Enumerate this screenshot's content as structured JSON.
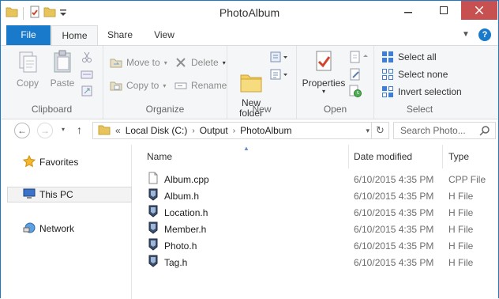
{
  "window": {
    "title": "PhotoAlbum"
  },
  "ribbon_tabs": {
    "file": "File",
    "home": "Home",
    "share": "Share",
    "view": "View"
  },
  "clipboard": {
    "copy": "Copy",
    "paste": "Paste",
    "label": "Clipboard"
  },
  "organize": {
    "move_to": "Move to",
    "copy_to": "Copy to",
    "delete": "Delete",
    "rename": "Rename",
    "label": "Organize"
  },
  "new_group": {
    "new_folder": "New\nfolder",
    "label": "New"
  },
  "open_group": {
    "properties": "Properties",
    "label": "Open"
  },
  "select_group": {
    "select_all": "Select all",
    "select_none": "Select none",
    "invert": "Invert selection",
    "label": "Select"
  },
  "address": {
    "overflow": "«",
    "crumbs": [
      "Local Disk (C:)",
      "Output",
      "PhotoAlbum"
    ],
    "search_placeholder": "Search Photo..."
  },
  "nav_pane": {
    "favorites": "Favorites",
    "this_pc": "This PC",
    "network": "Network"
  },
  "columns": {
    "name": "Name",
    "date": "Date modified",
    "type": "Type"
  },
  "files": [
    {
      "name": "Album.cpp",
      "date": "6/10/2015 4:35 PM",
      "type": "CPP File",
      "icon": "cpp-file-icon"
    },
    {
      "name": "Album.h",
      "date": "6/10/2015 4:35 PM",
      "type": "H File",
      "icon": "h-file-icon"
    },
    {
      "name": "Location.h",
      "date": "6/10/2015 4:35 PM",
      "type": "H File",
      "icon": "h-file-icon"
    },
    {
      "name": "Member.h",
      "date": "6/10/2015 4:35 PM",
      "type": "H File",
      "icon": "h-file-icon"
    },
    {
      "name": "Photo.h",
      "date": "6/10/2015 4:35 PM",
      "type": "H File",
      "icon": "h-file-icon"
    },
    {
      "name": "Tag.h",
      "date": "6/10/2015 4:35 PM",
      "type": "H File",
      "icon": "h-file-icon"
    }
  ],
  "colors": {
    "accent": "#1979ca",
    "close": "#c75050",
    "ribbon_bg": "#f5f6f7"
  }
}
